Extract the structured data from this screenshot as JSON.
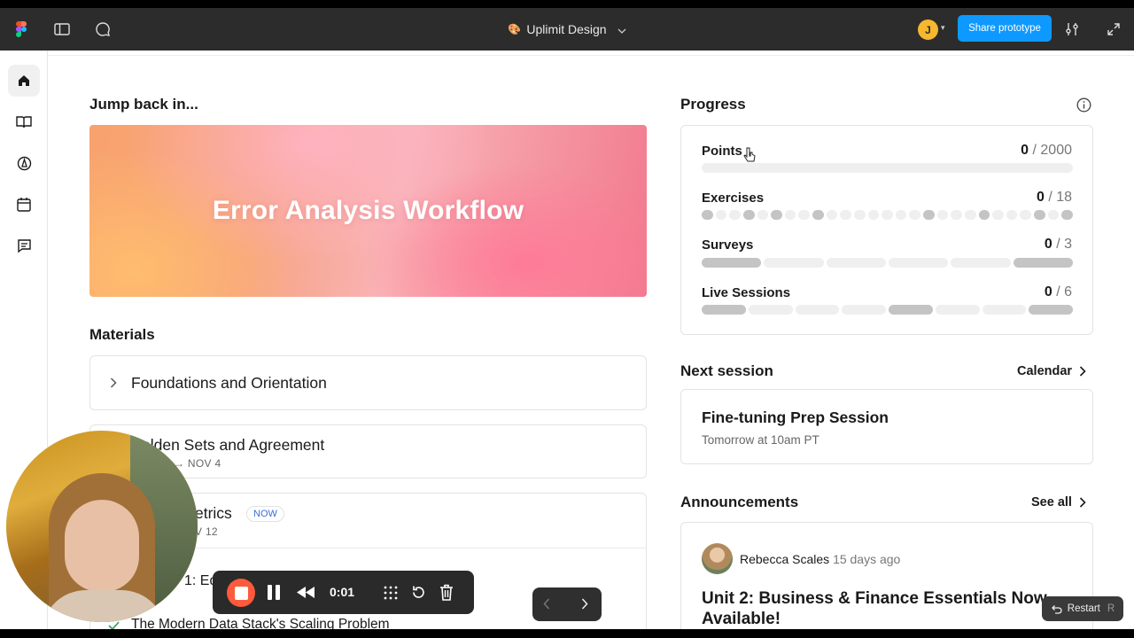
{
  "figma": {
    "file_name": "Uplimit Design",
    "share_label": "Share prototype",
    "avatar_initial": "J",
    "file_emoji": "🎨"
  },
  "colors": {
    "share_blue": "#0d99ff",
    "avatar_yellow": "#f5b82e",
    "now_badge": "#3a6fd8"
  },
  "sidebar": {
    "items": [
      {
        "name": "home-icon",
        "active": true
      },
      {
        "name": "book-icon",
        "active": false
      },
      {
        "name": "compass-icon",
        "active": false
      },
      {
        "name": "calendar-icon",
        "active": false
      },
      {
        "name": "message-icon",
        "active": false
      }
    ]
  },
  "main": {
    "jump_title": "Jump back in...",
    "hero_title": "Error Analysis Workflow",
    "materials_title": "Materials",
    "materials": [
      {
        "title": "Foundations and Orientation"
      },
      {
        "title": "Golden Sets and Agreement",
        "title_visible": "olden Sets and Agreement",
        "date": "→ NOV 4"
      },
      {
        "title_visible": "etrics",
        "badge": "NOW",
        "date": "V 12"
      },
      {
        "sub_visible": "1: Edi"
      },
      {
        "lesson": "The Modern Data Stack's Scaling Problem"
      }
    ]
  },
  "progress": {
    "title": "Progress",
    "rows": [
      {
        "label": "Points",
        "value": "0",
        "total": "/ 2000",
        "segments": 1,
        "dark": []
      },
      {
        "label": "Exercises",
        "value": "0",
        "total": "/ 18",
        "segments": 27,
        "dark": [
          0,
          3,
          5,
          8,
          16,
          20,
          24,
          26
        ]
      },
      {
        "label": "Surveys",
        "value": "0",
        "total": "/ 3",
        "segments": 6,
        "dark": [
          0,
          5
        ]
      },
      {
        "label": "Live Sessions",
        "value": "0",
        "total": "/ 6",
        "segments": 8,
        "dark": [
          0,
          4,
          7
        ]
      }
    ]
  },
  "next_session": {
    "title": "Next session",
    "link": "Calendar",
    "session_name": "Fine-tuning Prep Session",
    "session_time": "Tomorrow at 10am PT"
  },
  "announcements": {
    "title": "Announcements",
    "link": "See all",
    "author": "Rebecca Scales",
    "time": "15 days ago",
    "headline": "Unit 2: Business & Finance Essentials Now Available!"
  },
  "recorder": {
    "time": "0:01"
  },
  "restart": {
    "label": "Restart",
    "key": "R"
  }
}
